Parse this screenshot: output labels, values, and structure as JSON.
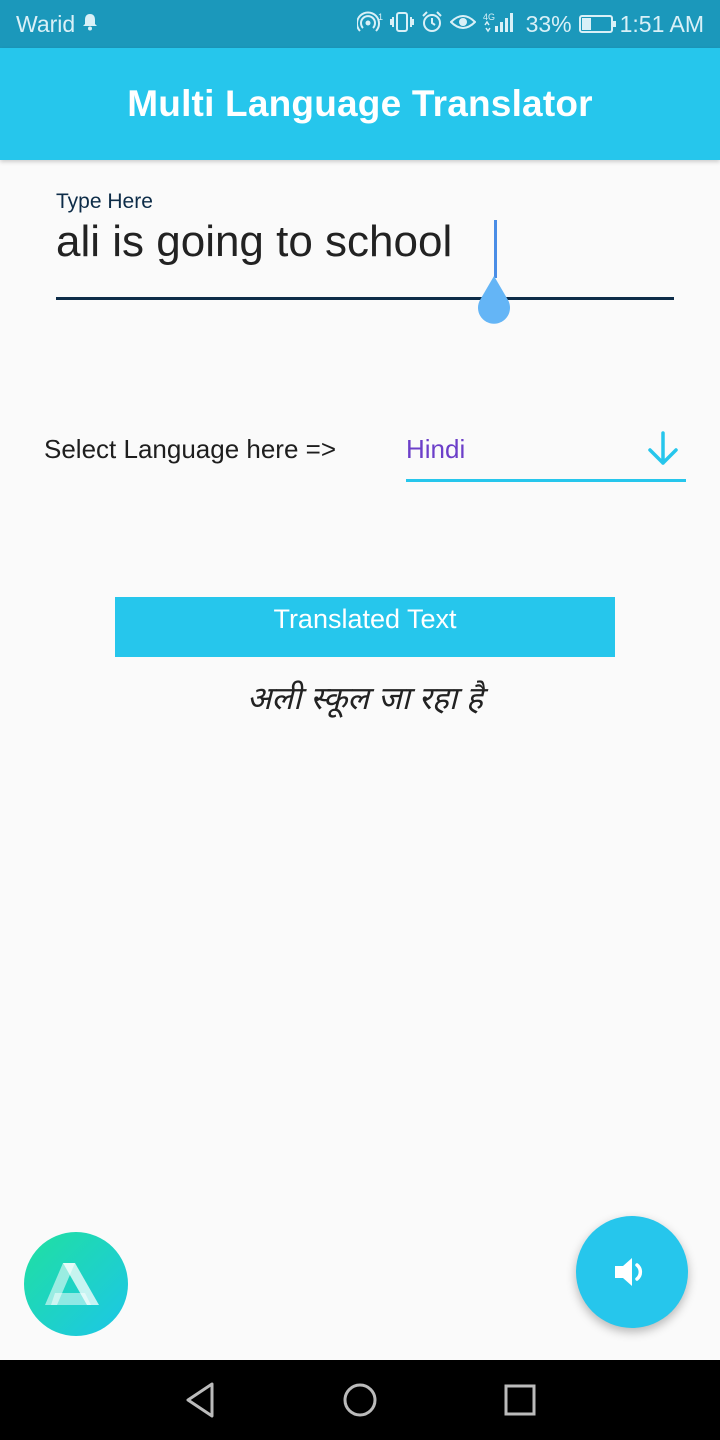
{
  "status_bar": {
    "carrier": "Warid",
    "network": "4G",
    "battery_percent": "33%",
    "battery_level": 0.33,
    "time": "1:51 AM",
    "icons": [
      "notification-bell-icon",
      "hotspot-icon",
      "vibrate-icon",
      "alarm-icon",
      "eye-comfort-icon",
      "signal-icon",
      "battery-icon"
    ]
  },
  "app_bar": {
    "title": "Multi Language Translator"
  },
  "input": {
    "label": "Type Here",
    "value": "ali is going to school"
  },
  "language": {
    "label": "Select Language here =>",
    "selected": "Hindi"
  },
  "translation": {
    "header": "Translated Text",
    "text": "अली स्कूल जा रहा है"
  },
  "fabs": {
    "left_icon": "app-logo-icon",
    "right_icon": "speaker-icon"
  },
  "nav": {
    "icons": [
      "back-icon",
      "home-icon",
      "recents-icon"
    ]
  },
  "colors": {
    "accent": "#26c6ec",
    "status_bar": "#1b98bb",
    "dropdown_text": "#6c3fc9",
    "input_underline": "#0d2c48",
    "cursor": "#4a8de6"
  }
}
